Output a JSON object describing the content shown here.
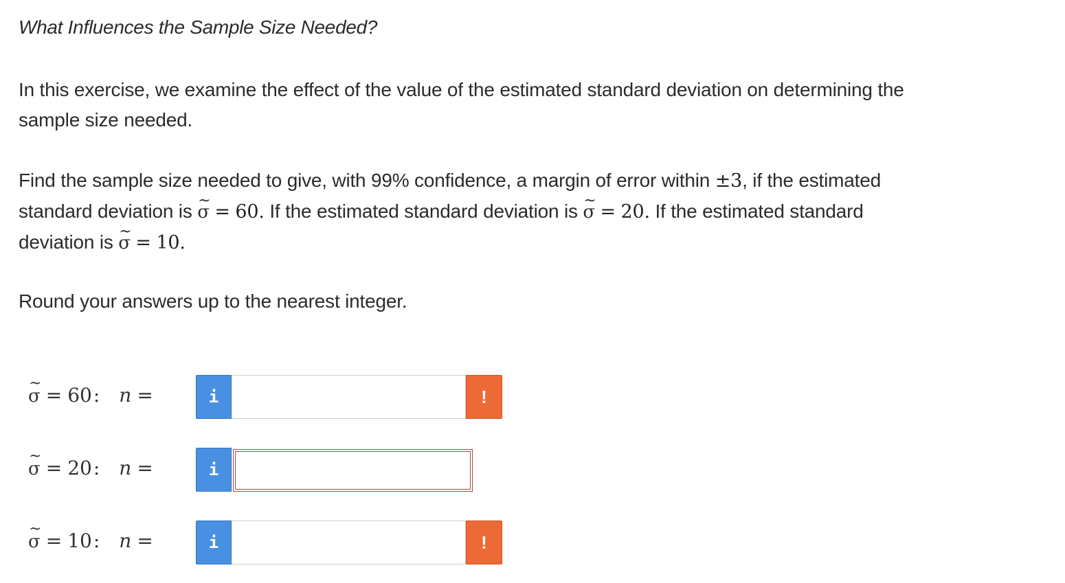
{
  "title": "What Influences the Sample Size Needed?",
  "intro": {
    "line1": "In this exercise, we examine the effect of the value of the estimated standard deviation on determining the",
    "line2": "sample size needed."
  },
  "question": {
    "l1_text": "Find the sample size needed to give, with 99% confidence, a margin of error within ",
    "margin": "±3",
    "l1_tail": ", if the estimated",
    "l2_a": "standard deviation is ",
    "sigma_symbol": "σ",
    "equals": "=",
    "val1": "60.",
    "l2_b": " If the estimated standard deviation is ",
    "val2": "20.",
    "l2_c": " If the estimated standard",
    "l3_a": "deviation is ",
    "val3": "10."
  },
  "instruction": "Round your answers up to the nearest integer.",
  "answers": [
    {
      "sigma": "60",
      "colon": ":",
      "n_label": "n",
      "equals": "=",
      "info": "i",
      "value": "",
      "warning": "!"
    },
    {
      "sigma": "20",
      "colon": ":",
      "n_label": "n",
      "equals": "=",
      "info": "i",
      "value": ""
    },
    {
      "sigma": "10",
      "colon": ":",
      "n_label": "n",
      "equals": "=",
      "info": "i",
      "value": "",
      "warning": "!"
    }
  ],
  "colors": {
    "info_blue": "#4a90e2",
    "warning_orange": "#ec6a35",
    "focus_border": "#9b4a4a"
  },
  "icons": {
    "info": "info-icon",
    "warning": "warning-icon"
  }
}
